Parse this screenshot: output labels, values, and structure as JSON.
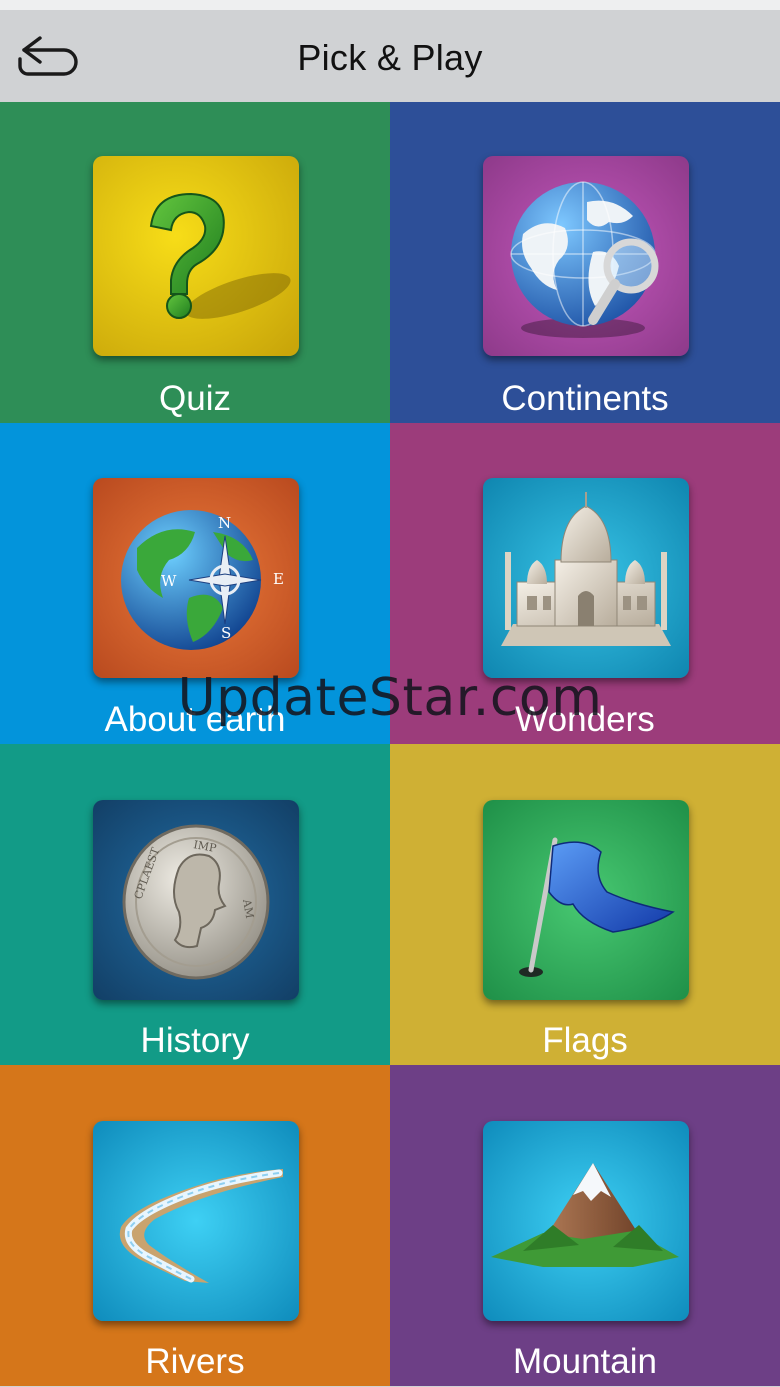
{
  "header": {
    "title": "Pick & Play",
    "back_icon": "back-arrow-icon"
  },
  "tiles": [
    {
      "label": "Quiz",
      "icon": "question-mark-icon",
      "bg": "#2e8e57",
      "icon_bg": "#e7c90f"
    },
    {
      "label": "Continents",
      "icon": "globe-magnifier-icon",
      "bg": "#2d4f98",
      "icon_bg": "#b04aa8"
    },
    {
      "label": "About earth",
      "icon": "earth-compass-icon",
      "bg": "#0394db",
      "icon_bg": "#d4582a"
    },
    {
      "label": "Wonders",
      "icon": "taj-mahal-icon",
      "bg": "#9c3c7b",
      "icon_bg": "#1aa3c8"
    },
    {
      "label": "History",
      "icon": "ancient-coin-icon",
      "bg": "#129b87",
      "icon_bg": "#1a5c8c"
    },
    {
      "label": "Flags",
      "icon": "flag-icon",
      "bg": "#cfb034",
      "icon_bg": "#34b45e"
    },
    {
      "label": "Rivers",
      "icon": "river-icon",
      "bg": "#d5761a",
      "icon_bg": "#17a8d6"
    },
    {
      "label": "Mountain",
      "icon": "mountain-icon",
      "bg": "#6d3f86",
      "icon_bg": "#17a8d6"
    }
  ],
  "watermark": "UpdateStar.com"
}
